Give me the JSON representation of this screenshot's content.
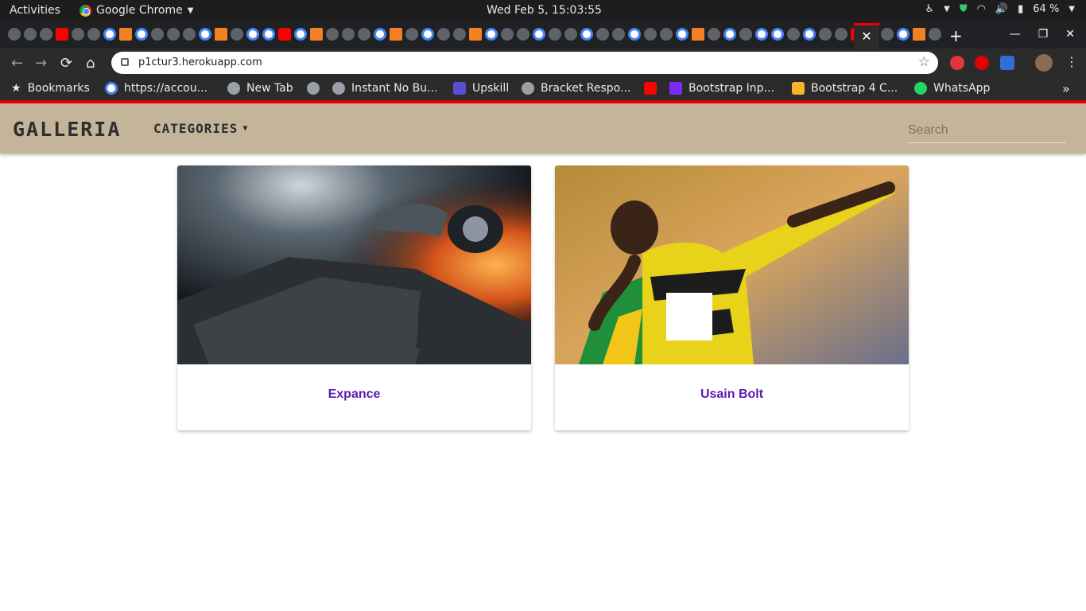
{
  "system": {
    "activities": "Activities",
    "app_name": "Google Chrome",
    "clock": "Wed Feb  5, 15:03:55",
    "battery": "64 %"
  },
  "browser": {
    "url": "p1ctur3.herokuapp.com",
    "bookmarks_label": "Bookmarks",
    "bookmarks": [
      {
        "label": "https://accou..."
      },
      {
        "label": "New Tab"
      },
      {
        "label": ""
      },
      {
        "label": "Instant No Bu..."
      },
      {
        "label": "Upskill"
      },
      {
        "label": "Bracket Respo..."
      },
      {
        "label": ""
      },
      {
        "label": "Bootstrap Inp..."
      },
      {
        "label": "Bootstrap 4 C..."
      },
      {
        "label": "WhatsApp"
      }
    ],
    "overflow": "»"
  },
  "site": {
    "brand": "Galleria",
    "categories_label": "Categories",
    "search_placeholder": "Search"
  },
  "cards": [
    {
      "title": "Expance",
      "image": "astronaut-in-space-battle-image"
    },
    {
      "title": "Usain Bolt",
      "image": "usain-bolt-celebrating-image"
    }
  ],
  "colors": {
    "navbar_bg": "#c4b49a",
    "card_title": "#5b1bb0",
    "accent_line": "#e00000"
  }
}
